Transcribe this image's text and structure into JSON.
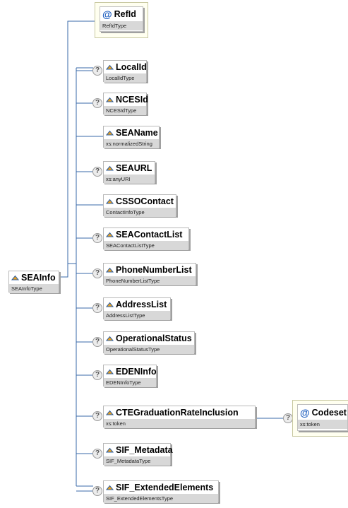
{
  "colors": {
    "connector": "#3a6aa8",
    "type_bar": "#d8d8d8",
    "attr_frame": "#fffff0",
    "at_icon": "#1f5fbf"
  },
  "icons": {
    "element": "element-icon",
    "attribute": "attribute-at-icon",
    "optional": "question-mark-icon"
  },
  "root": {
    "name": "SEAInfo",
    "type": "SEAInfoType"
  },
  "attribute": {
    "symbol": "@",
    "name": "RefId",
    "type": "RefIdType"
  },
  "elements": [
    {
      "name": "LocalId",
      "type": "LocalIdType",
      "optional": true
    },
    {
      "name": "NCESId",
      "type": "NCESIdType",
      "optional": true
    },
    {
      "name": "SEAName",
      "type": "xs:normalizedString",
      "optional": false
    },
    {
      "name": "SEAURL",
      "type": "xs:anyURI",
      "optional": true
    },
    {
      "name": "CSSOContact",
      "type": "ContactInfoType",
      "optional": false
    },
    {
      "name": "SEAContactList",
      "type": "SEAContactListType",
      "optional": true
    },
    {
      "name": "PhoneNumberList",
      "type": "PhoneNumberListType",
      "optional": true
    },
    {
      "name": "AddressList",
      "type": "AddressListType",
      "optional": true
    },
    {
      "name": "OperationalStatus",
      "type": "OperationalStatusType",
      "optional": true
    },
    {
      "name": "EDENInfo",
      "type": "EDENInfoType",
      "optional": true
    },
    {
      "name": "CTEGraduationRateInclusion",
      "type": "xs:token",
      "optional": true
    },
    {
      "name": "SIF_Metadata",
      "type": "SIF_MetadataType",
      "optional": true
    },
    {
      "name": "SIF_ExtendedElements",
      "type": "SIF_ExtendedElementsType",
      "optional": true
    }
  ],
  "child_attribute": {
    "symbol": "@",
    "name": "Codeset",
    "type": "xs:token",
    "optional": true
  }
}
